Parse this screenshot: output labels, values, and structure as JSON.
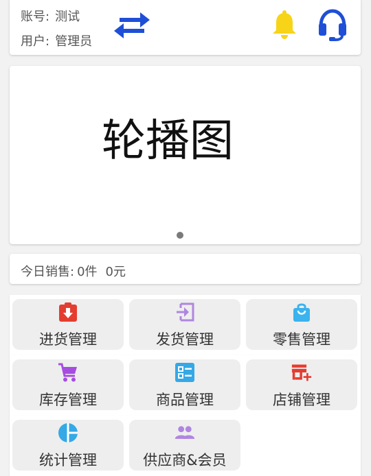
{
  "header": {
    "account_label": "账号:",
    "account_value": "测试",
    "user_label": "用户:",
    "user_value": "管理员",
    "icons": [
      "swap-icon",
      "bell-icon",
      "headset-icon"
    ],
    "colors": {
      "swap": "#1e4fd6",
      "bell": "#f7d417",
      "headset": "#1e4fd6"
    }
  },
  "carousel": {
    "text": "轮播图",
    "dot_color": "#7a7a7a"
  },
  "sales": {
    "label": "今日销售:",
    "count": "0件",
    "amount": "0元"
  },
  "menu": {
    "rows": [
      [
        {
          "label": "进货管理",
          "icon": "purchase-icon",
          "color": "#e43d30"
        },
        {
          "label": "发货管理",
          "icon": "ship-icon",
          "color": "#b085e0"
        },
        {
          "label": "零售管理",
          "icon": "shopping-bag-icon",
          "color": "#3ab3ee"
        }
      ],
      [
        {
          "label": "库存管理",
          "icon": "cart-icon",
          "color": "#a64de0"
        },
        {
          "label": "商品管理",
          "icon": "product-list-icon",
          "color": "#35a8e6"
        },
        {
          "label": "店铺管理",
          "icon": "store-icon",
          "color": "#e43d30"
        }
      ],
      [
        {
          "label": "统计管理",
          "icon": "pie-chart-icon",
          "color": "#35a8e6"
        },
        {
          "label": "供应商&会员",
          "icon": "people-icon",
          "color": "#b085e0"
        }
      ]
    ]
  }
}
